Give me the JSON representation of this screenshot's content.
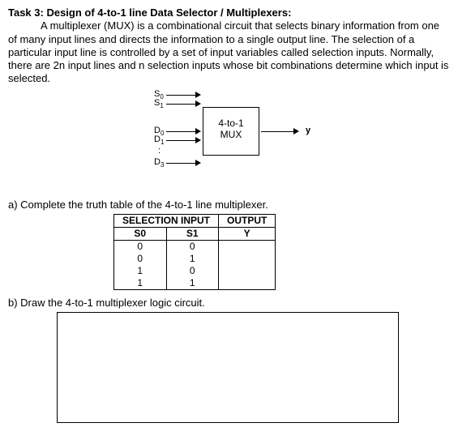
{
  "title": "Task 3: Design of 4-to-1 line Data Selector / Multiplexers:",
  "paragraph": "A multiplexer (MUX) is a combinational circuit that selects binary information from one of many input lines and directs the information to a single output line. The selection of a particular input line is controlled by a set of input variables called selection inputs. Normally, there are 2n input lines and n selection inputs whose bit combinations determine which input is selected.",
  "diagram": {
    "box_line1": "4-to-1",
    "box_line2": "MUX",
    "inputs_sel": [
      "S",
      "S"
    ],
    "inputs_sel_sub": [
      "0",
      "1"
    ],
    "inputs_data": [
      "D",
      "D",
      "D"
    ],
    "inputs_data_sub": [
      "0",
      "1",
      "3"
    ],
    "dots": ":",
    "output": "y"
  },
  "parts": {
    "a": "a)  Complete the truth table of the 4-to-1 line multiplexer.",
    "b": "b)  Draw the 4-to-1 multiplexer logic circuit."
  },
  "truth_table": {
    "header_sel": "SELECTION INPUT",
    "header_out": "OUTPUT",
    "col_s0": "S0",
    "col_s1": "S1",
    "col_y": "Y",
    "rows": [
      {
        "s0": "0",
        "s1": "0",
        "y": ""
      },
      {
        "s0": "0",
        "s1": "1",
        "y": ""
      },
      {
        "s0": "1",
        "s1": "0",
        "y": ""
      },
      {
        "s0": "1",
        "s1": "1",
        "y": ""
      }
    ]
  }
}
